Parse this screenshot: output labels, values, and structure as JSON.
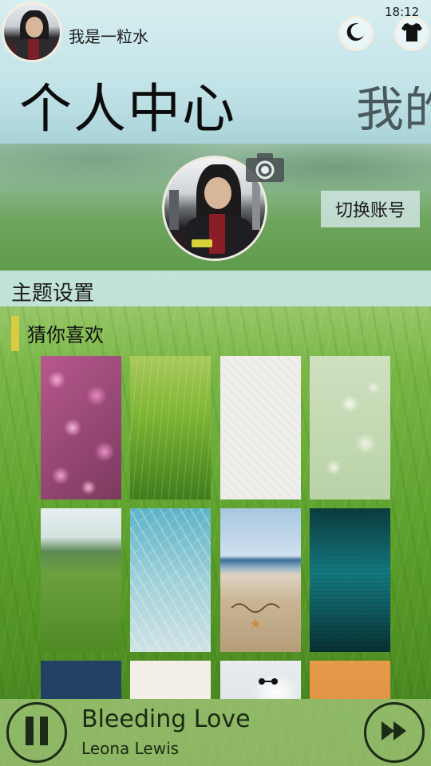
{
  "status": {
    "time": "18:12"
  },
  "user": {
    "name": "我是一粒水"
  },
  "pivot": {
    "current": "个人中心",
    "next_peek": "我的"
  },
  "profile": {
    "switch_account": "切换账号"
  },
  "theme": {
    "section_title": "主题设置",
    "recommend_label": "猜你喜欢",
    "accent_color": "#d9cc43",
    "thumbnails": [
      {
        "name": "pink-flowers"
      },
      {
        "name": "dewy-grass"
      },
      {
        "name": "white-paper"
      },
      {
        "name": "white-blossoms"
      },
      {
        "name": "green-field"
      },
      {
        "name": "frosted-ice"
      },
      {
        "name": "beach-happy-new-year"
      },
      {
        "name": "teal-gradient"
      },
      {
        "name": "denim-blue"
      },
      {
        "name": "strawberry-cake"
      },
      {
        "name": "white-robot"
      },
      {
        "name": "orange-wheat"
      }
    ]
  },
  "player": {
    "title": "Bleeding Love",
    "artist": "Leona Lewis"
  },
  "icons": {
    "moon": "moon-icon",
    "shirt": "shirt-icon",
    "camera": "camera-icon",
    "pause": "pause-icon",
    "fast_forward": "fast-forward-icon"
  }
}
